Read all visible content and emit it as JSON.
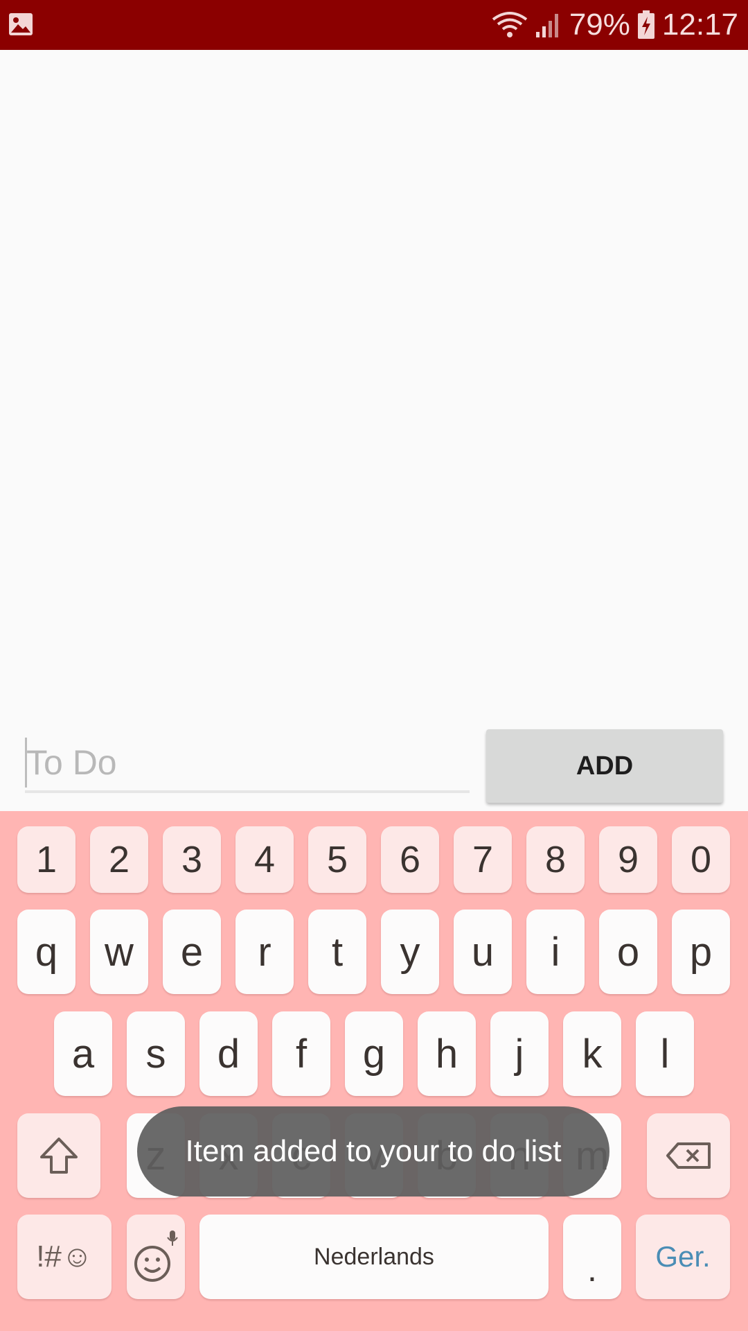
{
  "status_bar": {
    "battery_percent": "79%",
    "time": "12:17",
    "icons": [
      "gallery-icon",
      "wifi-icon",
      "signal-icon",
      "battery-charging-icon"
    ]
  },
  "todo": {
    "input_placeholder": "To Do",
    "input_value": "",
    "add_label": "ADD"
  },
  "keyboard": {
    "number_row": [
      "1",
      "2",
      "3",
      "4",
      "5",
      "6",
      "7",
      "8",
      "9",
      "0"
    ],
    "row1": [
      "q",
      "w",
      "e",
      "r",
      "t",
      "y",
      "u",
      "i",
      "o",
      "p"
    ],
    "row2": [
      "a",
      "s",
      "d",
      "f",
      "g",
      "h",
      "j",
      "k",
      "l"
    ],
    "row3": [
      "z",
      "x",
      "c",
      "v",
      "b",
      "n",
      "m"
    ],
    "symbols_label": "!#☺",
    "space_label": "Nederlands",
    "period_label": ".",
    "done_label": "Ger.",
    "icons": [
      "shift-icon",
      "backspace-icon",
      "emoji-mic-icon"
    ]
  },
  "toast": {
    "message": "Item added to your to do list"
  },
  "colors": {
    "status_bar": "#8b0000",
    "keyboard_bg": "#ffb5b3",
    "done_accent": "#4a8db5"
  }
}
